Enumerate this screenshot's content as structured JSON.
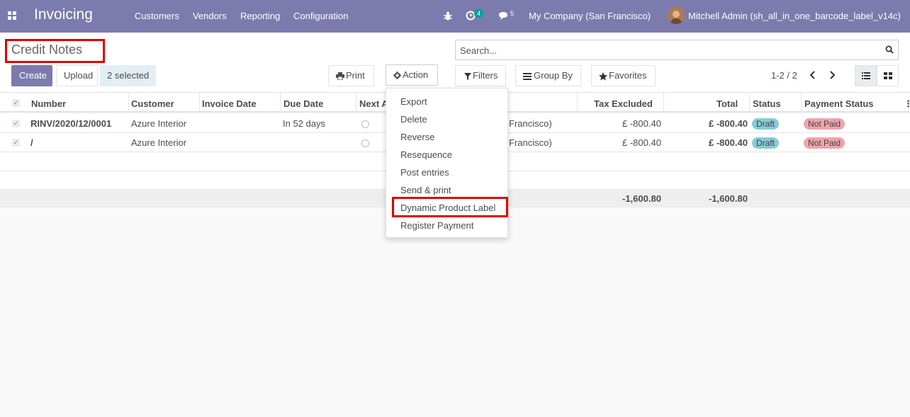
{
  "topbar": {
    "brand": "Invoicing",
    "menu": [
      "Customers",
      "Vendors",
      "Reporting",
      "Configuration"
    ],
    "activity_count": "4",
    "message_count": "5",
    "company": "My Company (San Francisco)",
    "user": "Mitchell Admin (sh_all_in_one_barcode_label_v14c)"
  },
  "control": {
    "title": "Credit Notes",
    "create_label": "Create",
    "upload_label": "Upload",
    "selected_label": "2 selected",
    "print_label": "Print",
    "action_label": "Action",
    "search_placeholder": "Search...",
    "filters_label": "Filters",
    "groupby_label": "Group By",
    "favorites_label": "Favorites",
    "pager": "1-2 / 2"
  },
  "table": {
    "headers": {
      "number": "Number",
      "customer": "Customer",
      "invoice_date": "Invoice Date",
      "due_date": "Due Date",
      "next_activity": "Next A",
      "tax_excluded": "Tax Excluded",
      "total": "Total",
      "status": "Status",
      "payment_status": "Payment Status"
    },
    "rows": [
      {
        "number": "RINV/2020/12/0001",
        "customer": "Azure Interior",
        "due": "In 52 days",
        "company_tail": "Francisco)",
        "tax_excluded": "£ -800.40",
        "total": "£ -800.40",
        "status": "Draft",
        "payment": "Not Paid"
      },
      {
        "number": "/",
        "customer": "Azure Interior",
        "due": "",
        "company_tail": "Francisco)",
        "tax_excluded": "£ -800.40",
        "total": "£ -800.40",
        "status": "Draft",
        "payment": "Not Paid"
      }
    ],
    "footer": {
      "tax_excluded": "-1,600.80",
      "total": "-1,600.80"
    }
  },
  "action_menu": {
    "items": [
      "Export",
      "Delete",
      "Reverse",
      "Resequence",
      "Post entries",
      "Send & print",
      "Dynamic Product Label",
      "Register Payment"
    ]
  },
  "colors": {
    "brand": "#7c7bad",
    "highlight": "#e00000",
    "draft": "#86cbd6",
    "not_paid": "#f0a3ab"
  }
}
